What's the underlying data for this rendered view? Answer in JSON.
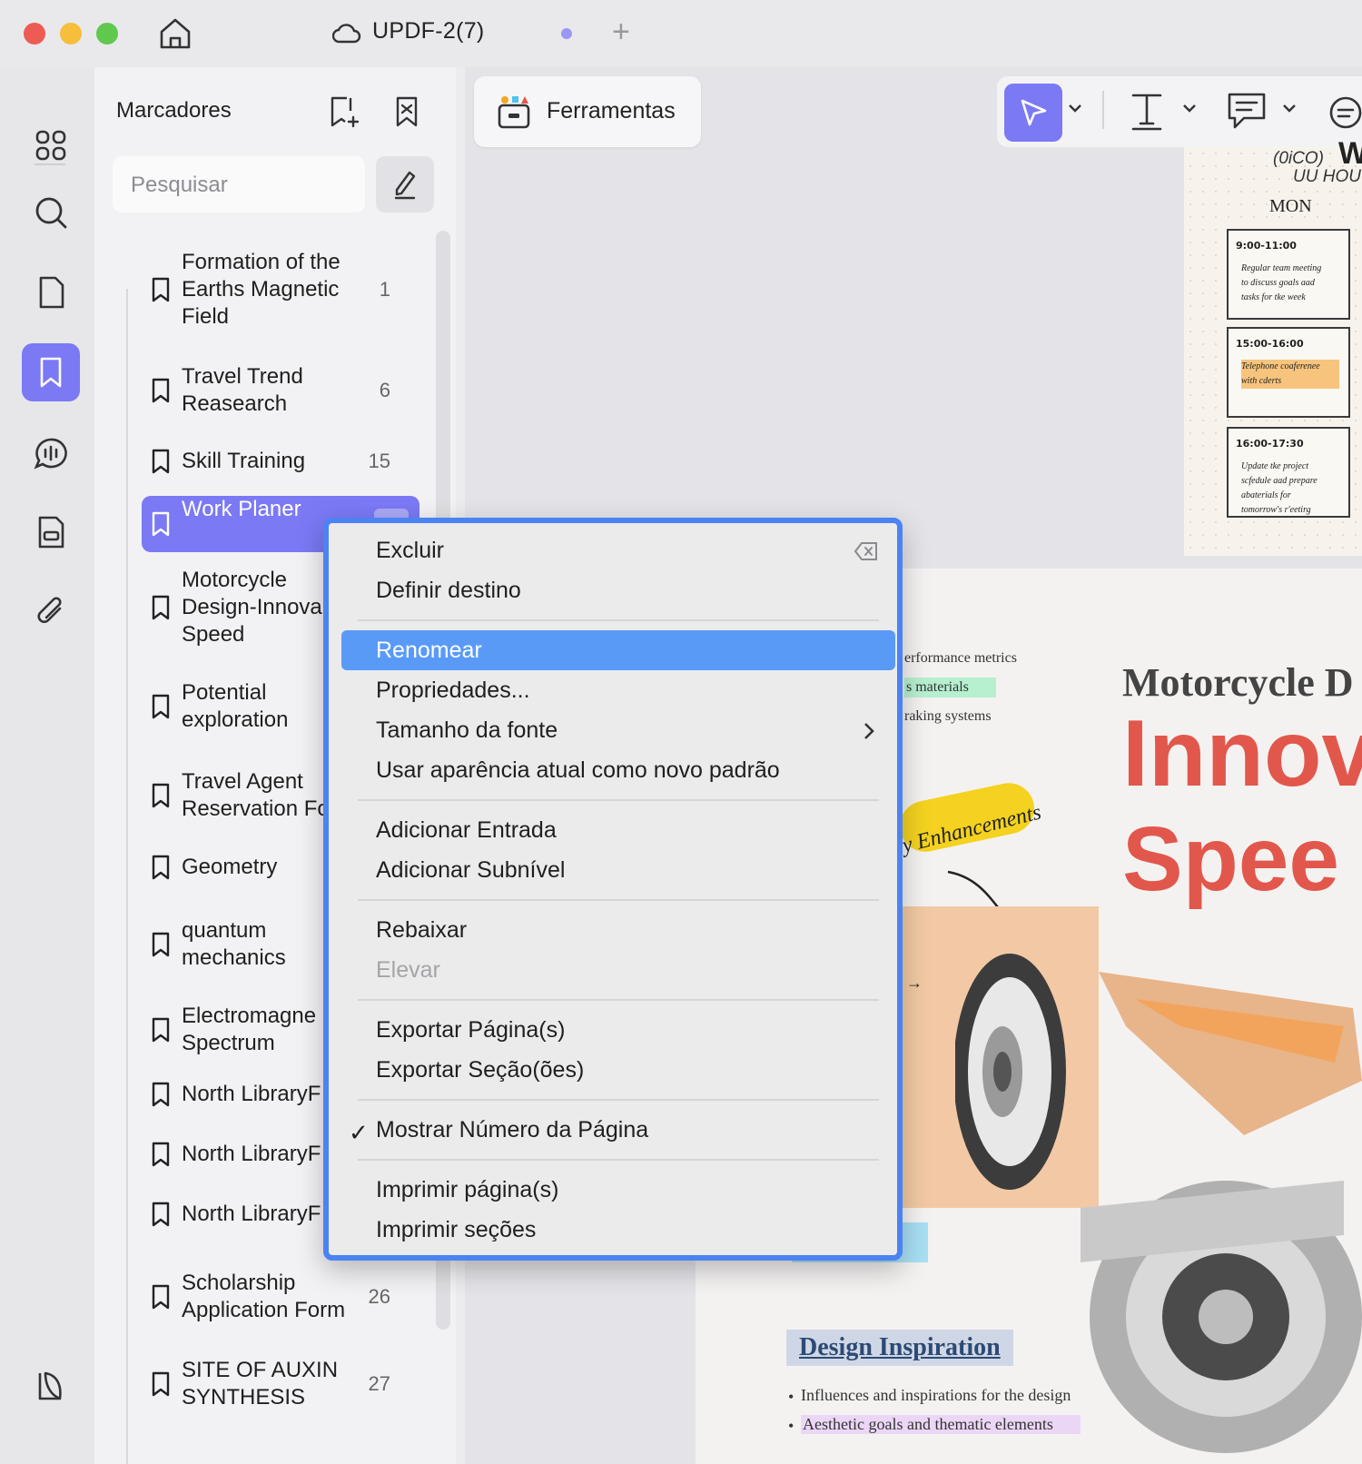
{
  "window": {
    "tab_title": "UPDF-2(7)"
  },
  "sidebar_panel": {
    "title": "Marcadores",
    "search_placeholder": "Pesquisar",
    "bookmarks": [
      {
        "label": "Formation of the\nEarths Magnetic\nField",
        "page": "1"
      },
      {
        "label": "Travel Trend\nReasearch",
        "page": "6"
      },
      {
        "label": "Skill Training",
        "page": "15"
      },
      {
        "label": "Work Planer",
        "page": "",
        "selected": true
      },
      {
        "label": "Motorcycle\nDesign-Innova\nSpeed",
        "page": ""
      },
      {
        "label": "Potential\nexploration",
        "page": ""
      },
      {
        "label": "Travel Agent\nReservation Fo",
        "page": ""
      },
      {
        "label": "Geometry",
        "page": ""
      },
      {
        "label": "quantum\nmechanics",
        "page": ""
      },
      {
        "label": "Electromagne\nSpectrum",
        "page": ""
      },
      {
        "label": "North LibraryF",
        "page": ""
      },
      {
        "label": "North LibraryF",
        "page": ""
      },
      {
        "label": "North LibraryF",
        "page": ""
      },
      {
        "label": "Scholarship\nApplication Form",
        "page": "26"
      },
      {
        "label": "SITE OF AUXIN\nSYNTHESIS",
        "page": "27"
      }
    ]
  },
  "toolbar": {
    "tools_label": "Ferramentas"
  },
  "context_menu": {
    "items": {
      "excluir": "Excluir",
      "definir_destino": "Definir destino",
      "renomear": "Renomear",
      "propriedades": "Propriedades...",
      "tamanho_fonte": "Tamanho da fonte",
      "usar_aparencia": "Usar aparência atual como novo padrão",
      "adicionar_entrada": "Adicionar Entrada",
      "adicionar_subnivel": "Adicionar Subnível",
      "rebaixar": "Rebaixar",
      "elevar": "Elevar",
      "exportar_paginas": "Exportar Página(s)",
      "exportar_secoes": "Exportar Seção(ões)",
      "mostrar_numero": "Mostrar Número da Página",
      "imprimir_paginas": "Imprimir página(s)",
      "imprimir_secoes": "Imprimir seções"
    },
    "highlighted": "Renomear",
    "checked": "Mostrar Número da Página"
  },
  "document": {
    "calendar_page": {
      "header_fragment": "(0iCO)",
      "header_fragment2": "UU HOU",
      "day": "MON",
      "slots": [
        {
          "time": "9:00-11:00",
          "note": "Regular team meeting\nto discuss goals aad\ntasks for tke week"
        },
        {
          "time": "15:00-16:00",
          "note": "Telephone coaferenee\nwith cderts"
        },
        {
          "time": "16:00-17:30",
          "note": "Update tke project\nscfedule aad prepare\nabaterials for\ntomorrow's r'eetirg"
        }
      ]
    },
    "poster_page": {
      "title_line1": "Motorcycle D",
      "title_line2": "Innov",
      "title_line3": "Spee",
      "bullet_fragments": [
        "erformance metrics",
        "s materials",
        "raking systems"
      ],
      "banner": "y Enhancements",
      "section_title": "Design Inspiration",
      "bullets": [
        "Influences and inspirations for the design",
        "Aesthetic goals and thematic elements"
      ]
    }
  },
  "colors": {
    "accent": "#7b79f4",
    "menu_highlight": "#5a9af7",
    "menu_border": "#4b83f2",
    "poster_red": "#e2574c"
  }
}
